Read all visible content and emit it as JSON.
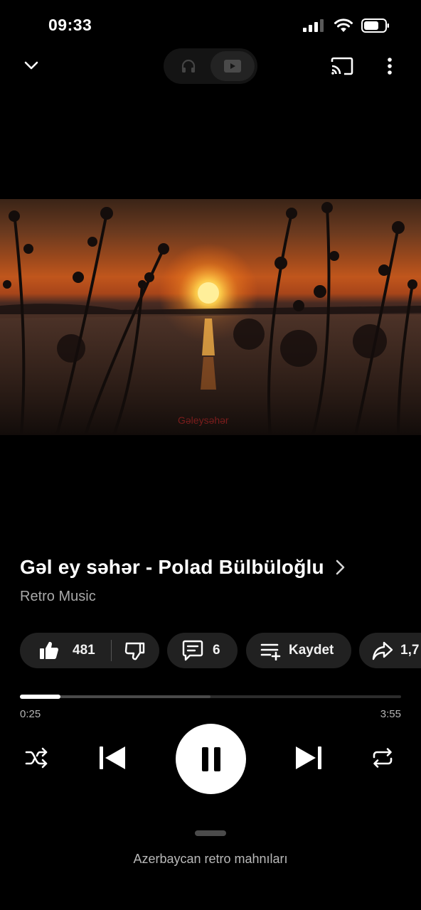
{
  "status_bar": {
    "time": "09:33",
    "icons": [
      "cellular-signal-icon",
      "wifi-icon",
      "battery-icon"
    ]
  },
  "top_bar": {
    "icons": [
      "chevron-down-icon",
      "headphones-icon",
      "video-icon",
      "cast-icon",
      "more-vertical-icon"
    ],
    "mode_toggle": {
      "options": [
        "audio",
        "video"
      ],
      "selected": "video"
    }
  },
  "video": {
    "watermark": "Gəleysəhər"
  },
  "song": {
    "title": "Gəl ey səhər - Polad Bülbüloğlu",
    "artist": "Retro Music"
  },
  "actions": {
    "like_count": "481",
    "comment_count": "6",
    "save_label": "Kaydet",
    "share_count": "1,7"
  },
  "progress": {
    "current": "0:25",
    "duration": "3:55",
    "played_fraction": 0.106,
    "buffered_fraction": 0.5
  },
  "controls": {
    "icons": [
      "shuffle-icon",
      "previous-icon",
      "pause-icon",
      "next-icon",
      "repeat-icon"
    ]
  },
  "up_next": {
    "label": "Azerbaycan retro mahnıları"
  },
  "colors": {
    "background": "#000000",
    "chip": "#212121",
    "progress_played": "#ffffff",
    "secondary_text": "#a9a9a9"
  }
}
